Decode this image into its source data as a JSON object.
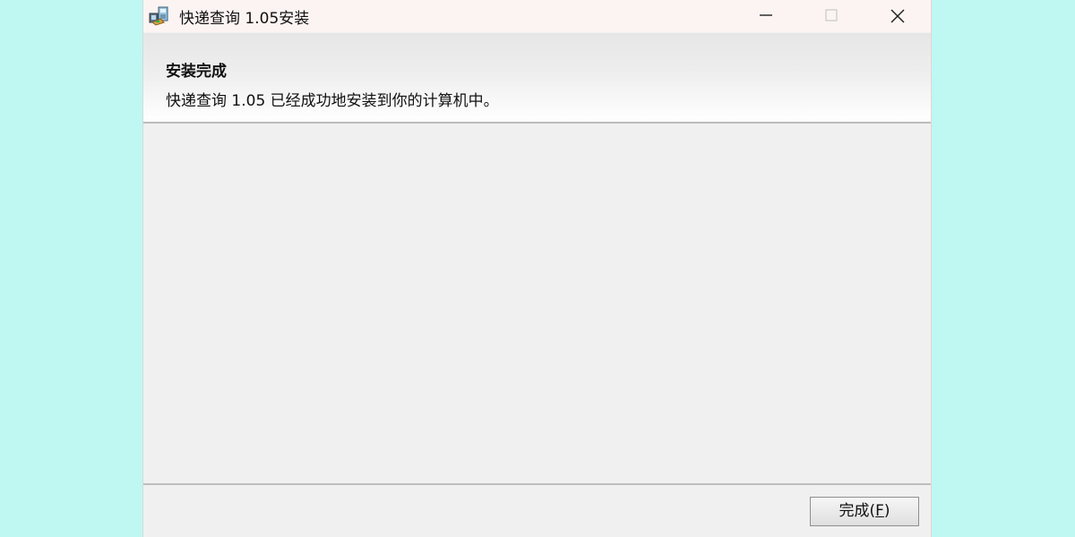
{
  "window": {
    "title": "快递查询 1.05安装",
    "controls": {
      "minimize": "minimize-icon",
      "maximize": "maximize-icon",
      "close": "close-icon"
    }
  },
  "header": {
    "title": "安装完成",
    "subtitle": "快递查询 1.05 已经成功地安装到你的计算机中。"
  },
  "footer": {
    "finish_label": "完成",
    "finish_open_paren": "(",
    "finish_mnemonic": "F",
    "finish_close_paren": ")"
  },
  "colors": {
    "background": "#bff7f3",
    "window": "#f0f0f0",
    "titlebar": "#fbf4f2"
  },
  "icons": {
    "app": "installer-icon"
  }
}
